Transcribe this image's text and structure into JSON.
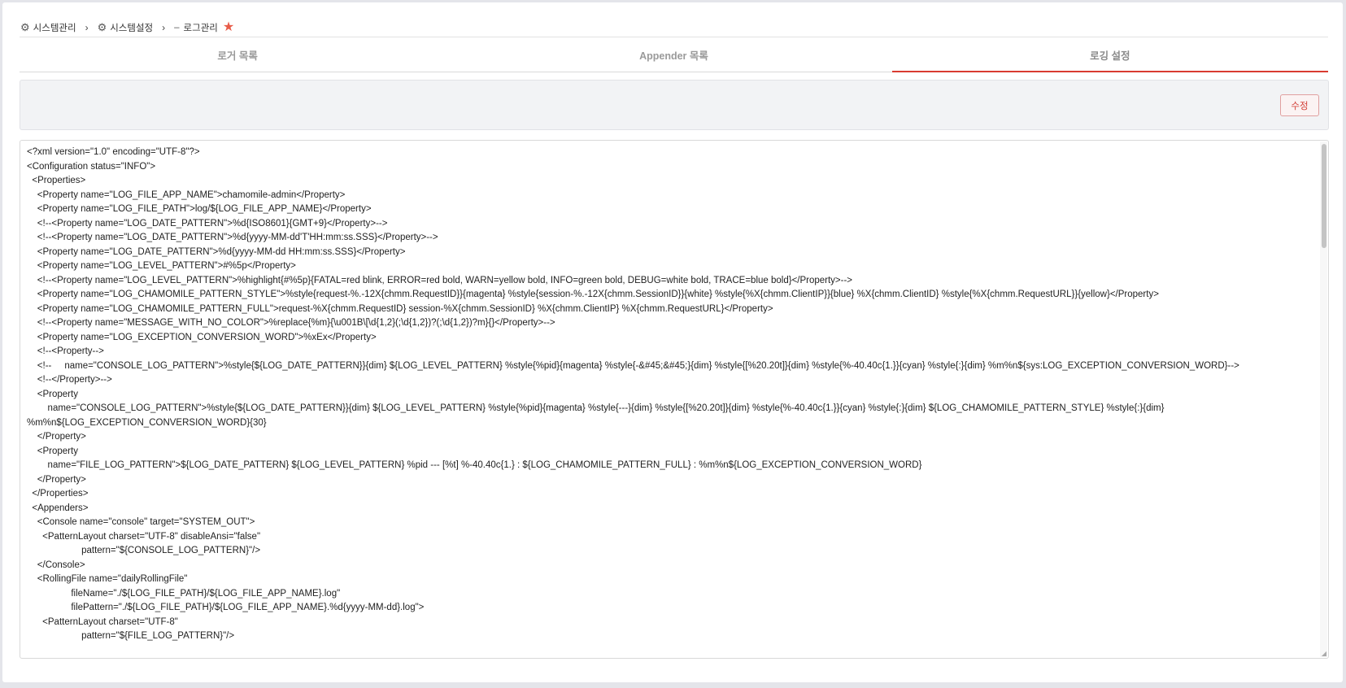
{
  "breadcrumb": {
    "items": [
      {
        "label": "시스템관리"
      },
      {
        "label": "시스템설정"
      },
      {
        "label": "로그관리"
      }
    ]
  },
  "tabs": [
    {
      "label": "로거 목록",
      "active": false
    },
    {
      "label": "Appender 목록",
      "active": false
    },
    {
      "label": "로깅 설정",
      "active": true
    }
  ],
  "toolbar": {
    "edit_label": "수정"
  },
  "colors": {
    "accent": "#d93b30",
    "star": "#e85c49",
    "background": "#e4e5ea"
  },
  "editor": {
    "lines": [
      "<?xml version=\"1.0\" encoding=\"UTF-8\"?>",
      "<Configuration status=\"INFO\">",
      "  <Properties>",
      "    <Property name=\"LOG_FILE_APP_NAME\">chamomile-admin</Property>",
      "    <Property name=\"LOG_FILE_PATH\">log/${LOG_FILE_APP_NAME}</Property>",
      "    <!--<Property name=\"LOG_DATE_PATTERN\">%d{ISO8601}{GMT+9}</Property>-->",
      "    <!--<Property name=\"LOG_DATE_PATTERN\">%d{yyyy-MM-dd'T'HH:mm:ss.SSS}</Property>-->",
      "    <Property name=\"LOG_DATE_PATTERN\">%d{yyyy-MM-dd HH:mm:ss.SSS}</Property>",
      "    <Property name=\"LOG_LEVEL_PATTERN\">#%5p</Property>",
      "    <!--<Property name=\"LOG_LEVEL_PATTERN\">%highlight{#%5p}{FATAL=red blink, ERROR=red bold, WARN=yellow bold, INFO=green bold, DEBUG=white bold, TRACE=blue bold}</Property>-->",
      "    <Property name=\"LOG_CHAMOMILE_PATTERN_STYLE\">%style{request-%.-12X{chmm.RequestID}}{magenta} %style{session-%.-12X{chmm.SessionID}}{white} %style{%X{chmm.ClientIP}}{blue} %X{chmm.ClientID} %style{%X{chmm.RequestURL}}{yellow}</Property>",
      "    <Property name=\"LOG_CHAMOMILE_PATTERN_FULL\">request-%X{chmm.RequestID} session-%X{chmm.SessionID} %X{chmm.ClientIP} %X{chmm.RequestURL}</Property>",
      "    <!--<Property name=\"MESSAGE_WITH_NO_COLOR\">%replace{%m}{\\u001B\\[\\d{1,2}(;\\d{1,2})?(;\\d{1,2})?m}{}</Property>-->",
      "    <Property name=\"LOG_EXCEPTION_CONVERSION_WORD\">%xEx</Property>",
      "    <!--<Property-->",
      "    <!--     name=\"CONSOLE_LOG_PATTERN\">%style{${LOG_DATE_PATTERN}}{dim} ${LOG_LEVEL_PATTERN} %style{%pid}{magenta} %style{-&#45;&#45;}{dim} %style{[%20.20t]}{dim} %style{%-40.40c{1.}}{cyan} %style{:}{dim} %m%n${sys:LOG_EXCEPTION_CONVERSION_WORD}-->",
      "    <!--</Property>-->",
      "    <Property",
      "        name=\"CONSOLE_LOG_PATTERN\">%style{${LOG_DATE_PATTERN}}{dim} ${LOG_LEVEL_PATTERN} %style{%pid}{magenta} %style{---}{dim} %style{[%20.20t]}{dim} %style{%-40.40c{1.}}{cyan} %style{:}{dim} ${LOG_CHAMOMILE_PATTERN_STYLE} %style{:}{dim}",
      "%m%n${LOG_EXCEPTION_CONVERSION_WORD}{30}",
      "    </Property>",
      "    <Property",
      "        name=\"FILE_LOG_PATTERN\">${LOG_DATE_PATTERN} ${LOG_LEVEL_PATTERN} %pid --- [%t] %-40.40c{1.} : ${LOG_CHAMOMILE_PATTERN_FULL} : %m%n${LOG_EXCEPTION_CONVERSION_WORD}",
      "    </Property>",
      "  </Properties>",
      "  <Appenders>",
      "    <Console name=\"console\" target=\"SYSTEM_OUT\">",
      "      <PatternLayout charset=\"UTF-8\" disableAnsi=\"false\"",
      "                     pattern=\"${CONSOLE_LOG_PATTERN}\"/>",
      "    </Console>",
      "    <RollingFile name=\"dailyRollingFile\"",
      "                 fileName=\"./${LOG_FILE_PATH}/${LOG_FILE_APP_NAME}.log\"",
      "                 filePattern=\"./${LOG_FILE_PATH}/${LOG_FILE_APP_NAME}.%d{yyyy-MM-dd}.log\">",
      "      <PatternLayout charset=\"UTF-8\"",
      "                     pattern=\"${FILE_LOG_PATTERN}\"/>"
    ]
  }
}
